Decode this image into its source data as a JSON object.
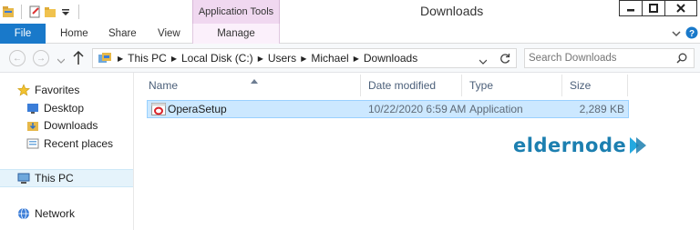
{
  "window": {
    "title": "Downloads",
    "contextual_group": "Application Tools"
  },
  "ribbon": {
    "tabs": [
      {
        "label": "File"
      },
      {
        "label": "Home"
      },
      {
        "label": "Share"
      },
      {
        "label": "View"
      },
      {
        "label": "Manage"
      }
    ]
  },
  "address": {
    "crumbs": [
      "This PC",
      "Local Disk (C:)",
      "Users",
      "Michael",
      "Downloads"
    ]
  },
  "search": {
    "placeholder": "Search Downloads"
  },
  "navigation": {
    "favorites_label": "Favorites",
    "favorites": [
      "Desktop",
      "Downloads",
      "Recent places"
    ],
    "this_pc": "This PC",
    "network": "Network"
  },
  "files": {
    "columns": [
      "Name",
      "Date modified",
      "Type",
      "Size"
    ],
    "rows": [
      {
        "name": "OperaSetup",
        "date": "10/22/2020 6:59 AM",
        "type": "Application",
        "size": "2,289 KB"
      }
    ]
  },
  "watermark": {
    "brand": "eldernode"
  },
  "colors": {
    "file_tab": "#1979ca",
    "contextual_tab": "#f0d8f0",
    "selection": "#cce8ff",
    "watermark": "#1c7fb0"
  }
}
